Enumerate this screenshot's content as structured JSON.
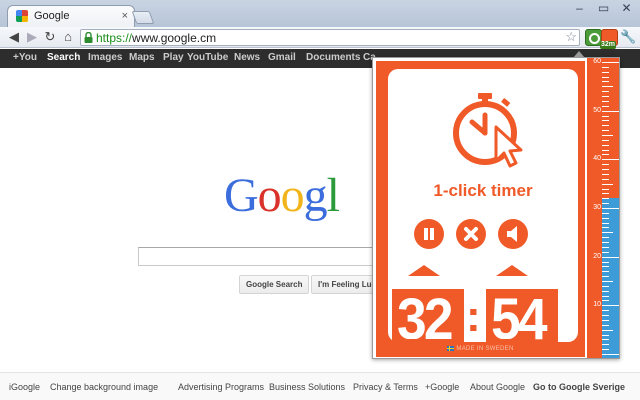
{
  "browser": {
    "tab_title": "Google",
    "tab_close": "×",
    "window_controls": [
      "–",
      "▭",
      "✕"
    ],
    "url_scheme": "https://",
    "url_host": "www.google.c",
    "url_caret": "m",
    "timer_badge": "32m"
  },
  "gbar": {
    "items": [
      "+You",
      "Search",
      "Images",
      "Maps",
      "Play",
      "YouTube",
      "News",
      "Gmail",
      "Documents",
      "Ca"
    ],
    "active": "Search"
  },
  "google": {
    "logo": [
      "G",
      "o",
      "o",
      "g",
      "l"
    ],
    "buttons": [
      "Google Search",
      "I'm Feeling Luck"
    ]
  },
  "footer": {
    "left": [
      "iGoogle",
      "Change background image"
    ],
    "right": [
      "Advertising Programs",
      "Business Solutions",
      "Privacy & Terms",
      "+Google",
      "About Google",
      "Go to Google Sverige"
    ]
  },
  "timer": {
    "title": "1-click timer",
    "minutes": "32",
    "separator": ":",
    "seconds": "54",
    "made_in": "MADE IN SWEDEN",
    "scale_labels": [
      "60",
      "50",
      "40",
      "30",
      "20",
      "10"
    ],
    "fill_minutes": 32,
    "scale_max": 60,
    "colors": {
      "accent": "#f05a28",
      "fill": "#3d9bd7"
    }
  }
}
